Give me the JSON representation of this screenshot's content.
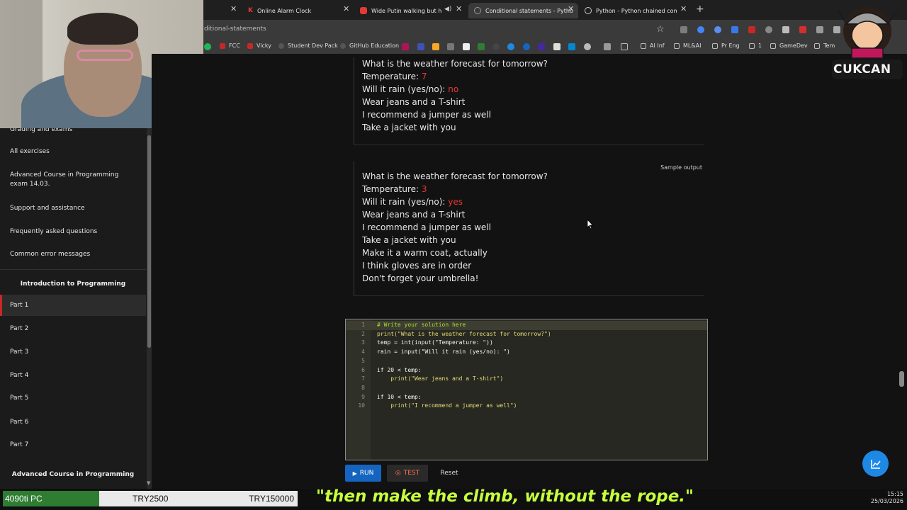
{
  "browser": {
    "tabs": [
      {
        "label": "Online Alarm Clock"
      },
      {
        "label": "Wide Putin walking but he's"
      },
      {
        "label": "Conditional statements - Pytho"
      },
      {
        "label": "Python - Python chained comp"
      }
    ],
    "url": "ditional-statements",
    "bookmarks": [
      "FCC",
      "Vicky",
      "Student Dev Pack",
      "GitHub Education",
      "AI Inf",
      "ML&AI",
      "Pr Eng",
      "1",
      "GameDev",
      "Tem"
    ]
  },
  "sidebar": {
    "items": [
      "Grading and exams",
      "All exercises",
      "Advanced Course in Programming exam 14.03.",
      "Support and assistance",
      "Frequently asked questions",
      "Common error messages"
    ],
    "section_heading": "Introduction to Programming",
    "parts": [
      "Part 1",
      "Part 2",
      "Part 3",
      "Part 4",
      "Part 5",
      "Part 6",
      "Part 7"
    ],
    "footer_heading": "Advanced Course in Programming"
  },
  "output1": {
    "prompt": "What is the weather forecast for tomorrow?",
    "temp_label": "Temperature: ",
    "temp_value": "7",
    "rain_label": "Will it rain (yes/no): ",
    "rain_value": "no",
    "line1": "Wear jeans and a T-shirt",
    "line2": "I recommend a jumper as well",
    "line3": "Take a jacket with you"
  },
  "output2": {
    "sample_label": "Sample output",
    "prompt": "What is the weather forecast for tomorrow?",
    "temp_label": "Temperature: ",
    "temp_value": "3",
    "rain_label": "Will it rain (yes/no): ",
    "rain_value": "yes",
    "line1": "Wear jeans and a T-shirt",
    "line2": "I recommend a jumper as well",
    "line3": "Take a jacket with you",
    "line4": "Make it a warm coat, actually",
    "line5": "I think gloves are in order",
    "line6": "Don't forget your umbrella!"
  },
  "editor": {
    "line_numbers": [
      "1",
      "2",
      "3",
      "4",
      "5",
      "6",
      "7",
      "8",
      "9",
      "10"
    ],
    "lines": [
      "# Write your solution here",
      "print(\"What is the weather forecast for tomorrow?\")",
      "temp = int(input(\"Temperature: \"))",
      "rain = input(\"Will it rain (yes/no): \")",
      "",
      "if 20 < temp:",
      "    print(\"Wear jeans and a T-shirt\")",
      "",
      "if 10 < temp:",
      "    print(\"I recommend a jumper as well\")"
    ]
  },
  "buttons": {
    "run": "RUN",
    "test": "TEST",
    "reset": "Reset"
  },
  "logo": {
    "text": "CUKCAN"
  },
  "stream": {
    "ticker1": "4090ti PC",
    "ticker2": "TRY2500",
    "ticker3": "TRY150000",
    "quote": "\"then make the climb, without the rope.\"",
    "time": "15:15",
    "date": "25/03/2026"
  }
}
